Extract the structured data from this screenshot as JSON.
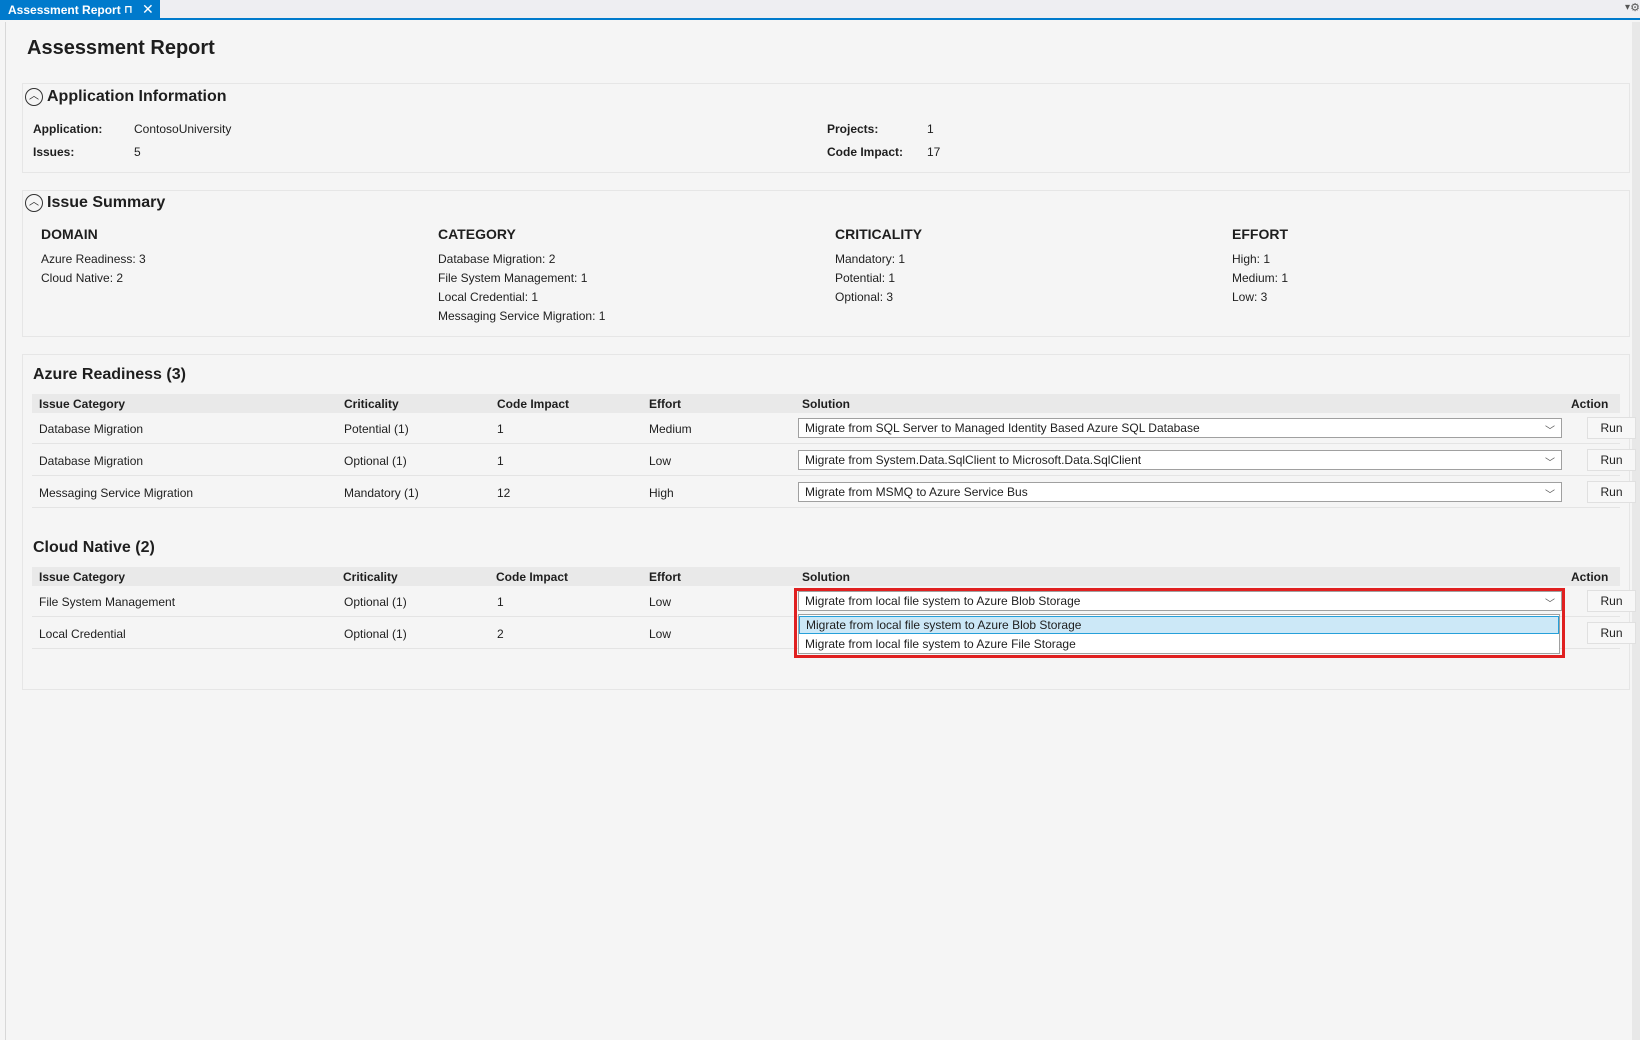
{
  "tab": {
    "title": "Assessment Report",
    "pin": "⊓",
    "close": "✕",
    "dropdown": "▾",
    "gear": "⚙"
  },
  "page": {
    "title": "Assessment Report"
  },
  "app_info": {
    "title": "Application Information",
    "application_label": "Application:",
    "application_value": "ContosoUniversity",
    "issues_label": "Issues:",
    "issues_value": "5",
    "projects_label": "Projects:",
    "projects_value": "1",
    "code_impact_label": "Code Impact:",
    "code_impact_value": "17"
  },
  "summary": {
    "title": "Issue Summary",
    "columns": [
      {
        "heading": "DOMAIN",
        "lines": [
          "Azure Readiness:  3",
          "Cloud Native:  2"
        ]
      },
      {
        "heading": "CATEGORY",
        "lines": [
          "Database Migration:  2",
          "File System Management:  1",
          "Local Credential:  1",
          "Messaging Service Migration:  1"
        ]
      },
      {
        "heading": "CRITICALITY",
        "lines": [
          "Mandatory:  1",
          "Potential:  1",
          "Optional:  3"
        ]
      },
      {
        "heading": "EFFORT",
        "lines": [
          "High:  1",
          "Medium:  1",
          "Low:  3"
        ]
      }
    ]
  },
  "table_headers": {
    "issue_category": "Issue Category",
    "criticality": "Criticality",
    "code_impact": "Code Impact",
    "effort": "Effort",
    "solution": "Solution",
    "action": "Action"
  },
  "azure": {
    "title": "Azure Readiness (3)",
    "rows": [
      {
        "category": "Database Migration",
        "criticality": "Potential (1)",
        "impact": "1",
        "effort": "Medium",
        "solution": "Migrate from SQL Server to Managed Identity Based Azure SQL Database",
        "action": "Run"
      },
      {
        "category": "Database Migration",
        "criticality": "Optional (1)",
        "impact": "1",
        "effort": "Low",
        "solution": "Migrate from System.Data.SqlClient to Microsoft.Data.SqlClient",
        "action": "Run"
      },
      {
        "category": "Messaging Service Migration",
        "criticality": "Mandatory (1)",
        "impact": "12",
        "effort": "High",
        "solution": "Migrate from MSMQ to Azure Service Bus",
        "action": "Run"
      }
    ]
  },
  "cloud": {
    "title": "Cloud Native (2)",
    "rows": [
      {
        "category": "File System Management",
        "criticality": "Optional (1)",
        "impact": "1",
        "effort": "Low",
        "solution": "Migrate from local file system to Azure Blob Storage",
        "action": "Run"
      },
      {
        "category": "Local Credential",
        "criticality": "Optional (1)",
        "impact": "2",
        "effort": "Low",
        "action": "Run"
      }
    ],
    "dropdown_options": [
      "Migrate from local file system to Azure Blob Storage",
      "Migrate from local file system to Azure File Storage"
    ]
  },
  "icons": {
    "collapse": "chevron-up-in-circle",
    "combo": "chevron-down"
  }
}
